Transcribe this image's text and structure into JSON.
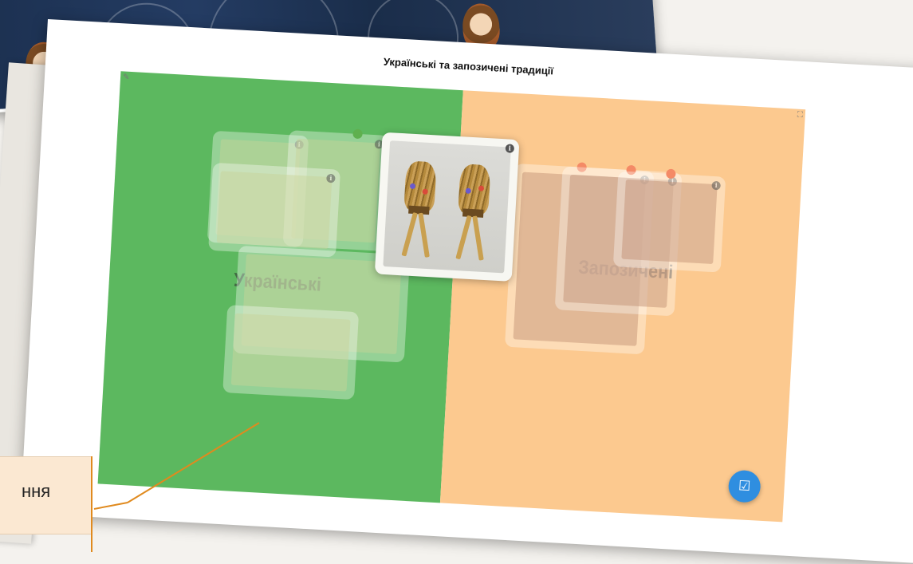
{
  "slide": {
    "title": "Українські та запозичені традиції"
  },
  "zones": {
    "left_label": "Українські",
    "right_label": "Запозичені"
  },
  "colors": {
    "left_zone": "#5cb85f",
    "right_zone": "#fcc98f",
    "check_button": "#2f8ee0",
    "callout_line": "#e08a1e"
  },
  "icons": {
    "info": "info-icon",
    "check": "check-icon",
    "fullscreen": "fullscreen-icon",
    "edit": "edit-icon"
  },
  "callout": {
    "text": "ння"
  }
}
